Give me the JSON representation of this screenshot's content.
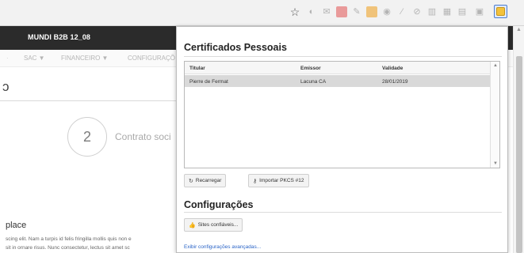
{
  "toolbar": {
    "icons": [
      "star-icon",
      "ext-icon",
      "ext-icon",
      "ext-icon",
      "ext-icon",
      "ext-icon",
      "ext-icon",
      "ext-icon",
      "ext-icon",
      "ext-icon",
      "ext-icon",
      "ext-icon",
      "ext-icon",
      "certificate-extension-icon",
      "menu-icon"
    ]
  },
  "site": {
    "brand": "MUNDI B2B 12_08",
    "nav": {
      "separator": "·",
      "sac": "SAC ▼",
      "financeiro": "FINANCEIRO ▼",
      "configuracoes": "CONFIGURAÇÕ"
    },
    "heading": "ɔ",
    "step": {
      "number": "2",
      "label": "Contrato soci"
    },
    "place_title": "place",
    "place_text": [
      "scing elit. Nam a turpis id felis fringilla mollis quis non e",
      "sit in ornare risus. Nunc consectetur, lectus sit amet sc"
    ]
  },
  "popup": {
    "personal_certs_title": "Certificados Pessoais",
    "table": {
      "columns": [
        "Titular",
        "Emissor",
        "Validade"
      ],
      "rows": [
        [
          "Pierre de Fermat",
          "Lacuna CA",
          "28/01/2019"
        ]
      ]
    },
    "reload_label": "Recarregar",
    "import_label": "Importar PKCS #12",
    "config_title": "Configurações",
    "trusted_sites_label": "Sites confiáveis...",
    "advanced_link": "Exibir configurações avançadas..."
  },
  "colors": {
    "site_header_bg": "#2b2b2b",
    "accent_red": "#e2241b",
    "link_blue": "#2a64c7",
    "selected_row_bg": "#d9d9d9"
  }
}
